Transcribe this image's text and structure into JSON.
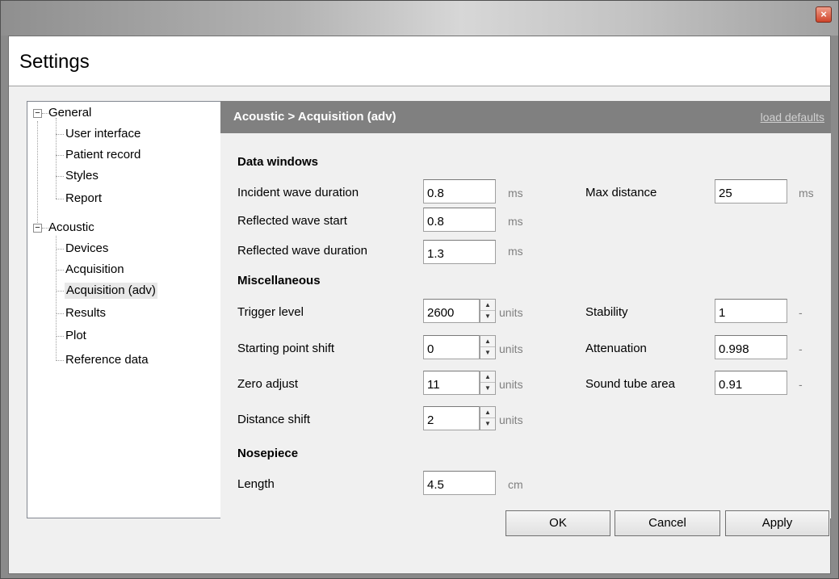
{
  "window": {
    "close_glyph": "×"
  },
  "header": {
    "title": "Settings"
  },
  "tree": [
    {
      "label": "General",
      "expander": "−"
    },
    {
      "label": "User interface"
    },
    {
      "label": "Patient record"
    },
    {
      "label": "Styles"
    },
    {
      "label": "Report"
    },
    {
      "label": "Acoustic",
      "expander": "−"
    },
    {
      "label": "Devices"
    },
    {
      "label": "Acquisition"
    },
    {
      "label": "Acquisition (adv)",
      "selected": true
    },
    {
      "label": "Results"
    },
    {
      "label": "Plot"
    },
    {
      "label": "Reference data"
    }
  ],
  "panel": {
    "title": "Acoustic > Acquisition (adv)",
    "load_defaults": "load defaults",
    "data_windows": {
      "heading": "Data windows",
      "incident_label": "Incident wave duration",
      "incident_value": "0.8",
      "incident_unit": "ms",
      "reflected_start_label": "Reflected wave start",
      "reflected_start_value": "0.8",
      "reflected_start_unit": "ms",
      "reflected_duration_label": "Reflected wave duration",
      "reflected_duration_value": "1.3",
      "reflected_duration_unit": "ms",
      "max_distance_label": "Max distance",
      "max_distance_value": "25",
      "max_distance_unit": "ms"
    },
    "misc": {
      "heading": "Miscellaneous",
      "trigger_label": "Trigger level",
      "trigger_value": "2600",
      "trigger_unit": "units",
      "starting_label": "Starting point shift",
      "starting_value": "0",
      "starting_unit": "units",
      "zero_label": "Zero adjust",
      "zero_value": "11",
      "zero_unit": "units",
      "distance_label": "Distance shift",
      "distance_value": "2",
      "distance_unit": "units",
      "stability_label": "Stability",
      "stability_value": "1",
      "stability_unit": "-",
      "attenuation_label": "Attenuation",
      "attenuation_value": "0.998",
      "attenuation_unit": "-",
      "sound_tube_label": "Sound tube area",
      "sound_tube_value": "0.91",
      "sound_tube_unit": "-"
    },
    "nosepiece": {
      "heading": "Nosepiece",
      "length_label": "Length",
      "length_value": "4.5",
      "length_unit": "cm"
    }
  },
  "buttons": {
    "ok": "OK",
    "cancel": "Cancel",
    "apply": "Apply"
  }
}
